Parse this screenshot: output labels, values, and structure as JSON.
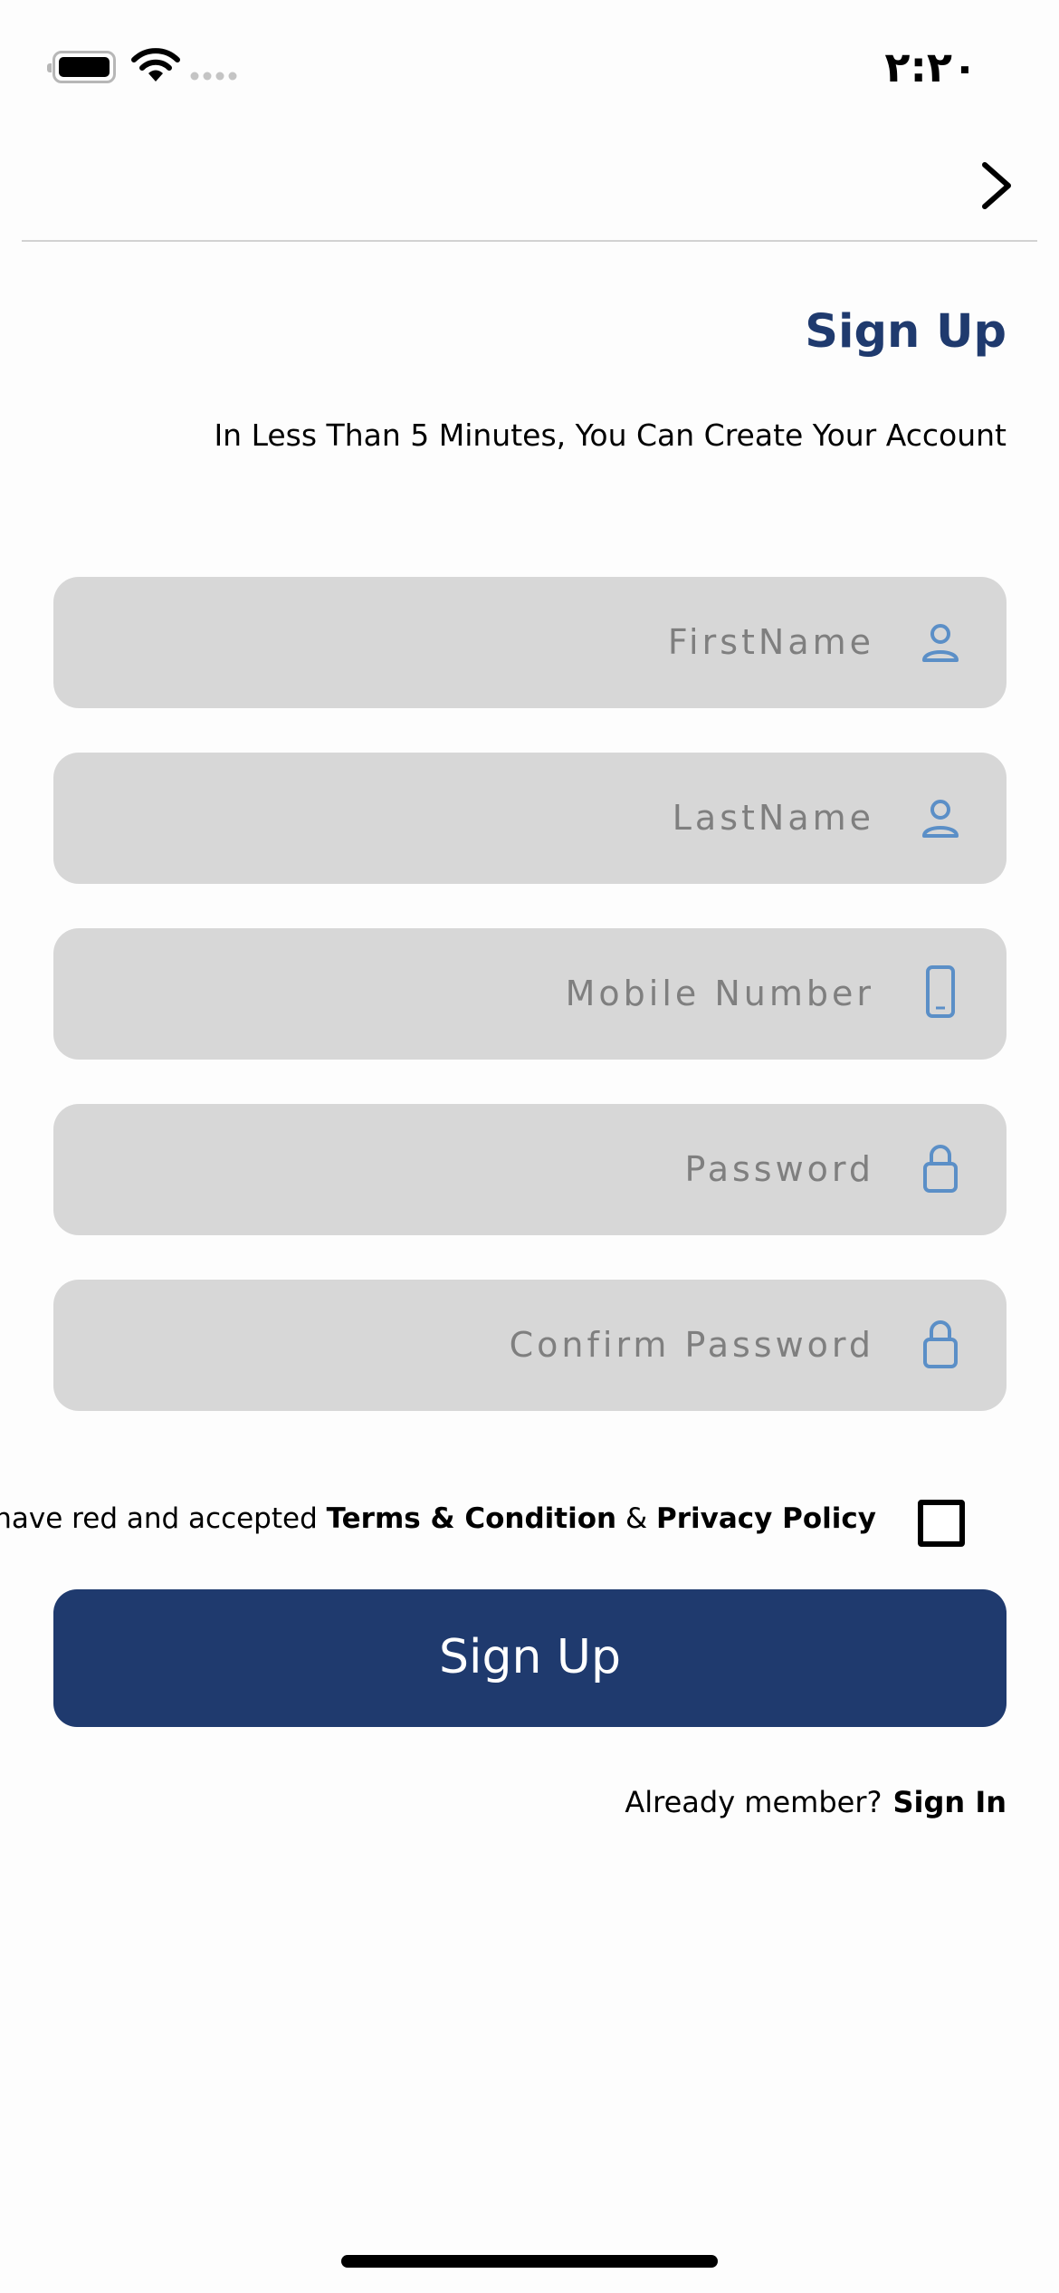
{
  "status_bar": {
    "time": "۲:۲۰"
  },
  "header": {
    "back_icon": "chevron-right-icon"
  },
  "page": {
    "title": "Sign Up",
    "subtitle": "In Less Than 5 Minutes, You Can Create Your Account"
  },
  "form": {
    "fields": [
      {
        "placeholder": "FirstName",
        "icon": "user-icon"
      },
      {
        "placeholder": "LastName",
        "icon": "user-icon"
      },
      {
        "placeholder": "Mobile Number",
        "icon": "mobile-phone-icon"
      },
      {
        "placeholder": "Password",
        "icon": "lock-icon"
      },
      {
        "placeholder": "Confirm Password",
        "icon": "lock-icon"
      }
    ],
    "terms": {
      "prefix": "I have red and accepted",
      "terms_link": "Terms & Condition",
      "joiner": "&",
      "privacy_link": "Privacy Policy",
      "checked": false
    },
    "submit_label": "Sign Up"
  },
  "footer": {
    "already_member": "Already member?",
    "sign_in_label": "Sign In"
  },
  "colors": {
    "primary": "#1f3a6e",
    "field_bg": "#d7d7d7",
    "icon": "#5b8fc7",
    "placeholder": "#7f7f7f"
  }
}
